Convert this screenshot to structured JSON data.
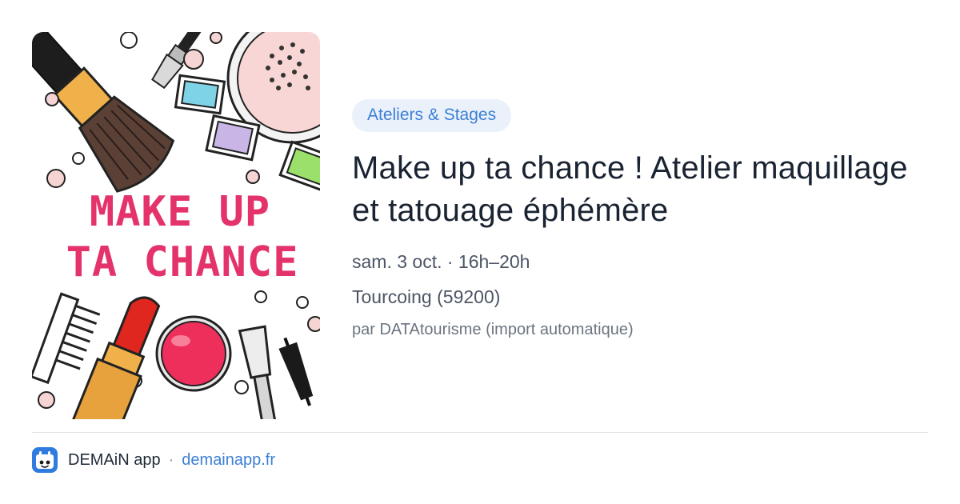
{
  "event": {
    "category": "Ateliers & Stages",
    "title": "Make up ta chance ! Atelier maquillage et tatouage éphémère",
    "datetime": "sam. 3 oct. · 16h–20h",
    "location": "Tourcoing (59200)",
    "source": "par DATAtourisme (import automatique)",
    "cover_text_line1": "MAKE UP",
    "cover_text_line2": "TA CHANCE"
  },
  "footer": {
    "app_name": "DEMAiN app",
    "separator": "·",
    "link_text": "demainapp.fr",
    "logo_icon": "demain-logo-icon"
  },
  "colors": {
    "accent": "#3d7fd6",
    "chip_bg": "#eaf1fb",
    "cover_text": "#e4336a"
  }
}
